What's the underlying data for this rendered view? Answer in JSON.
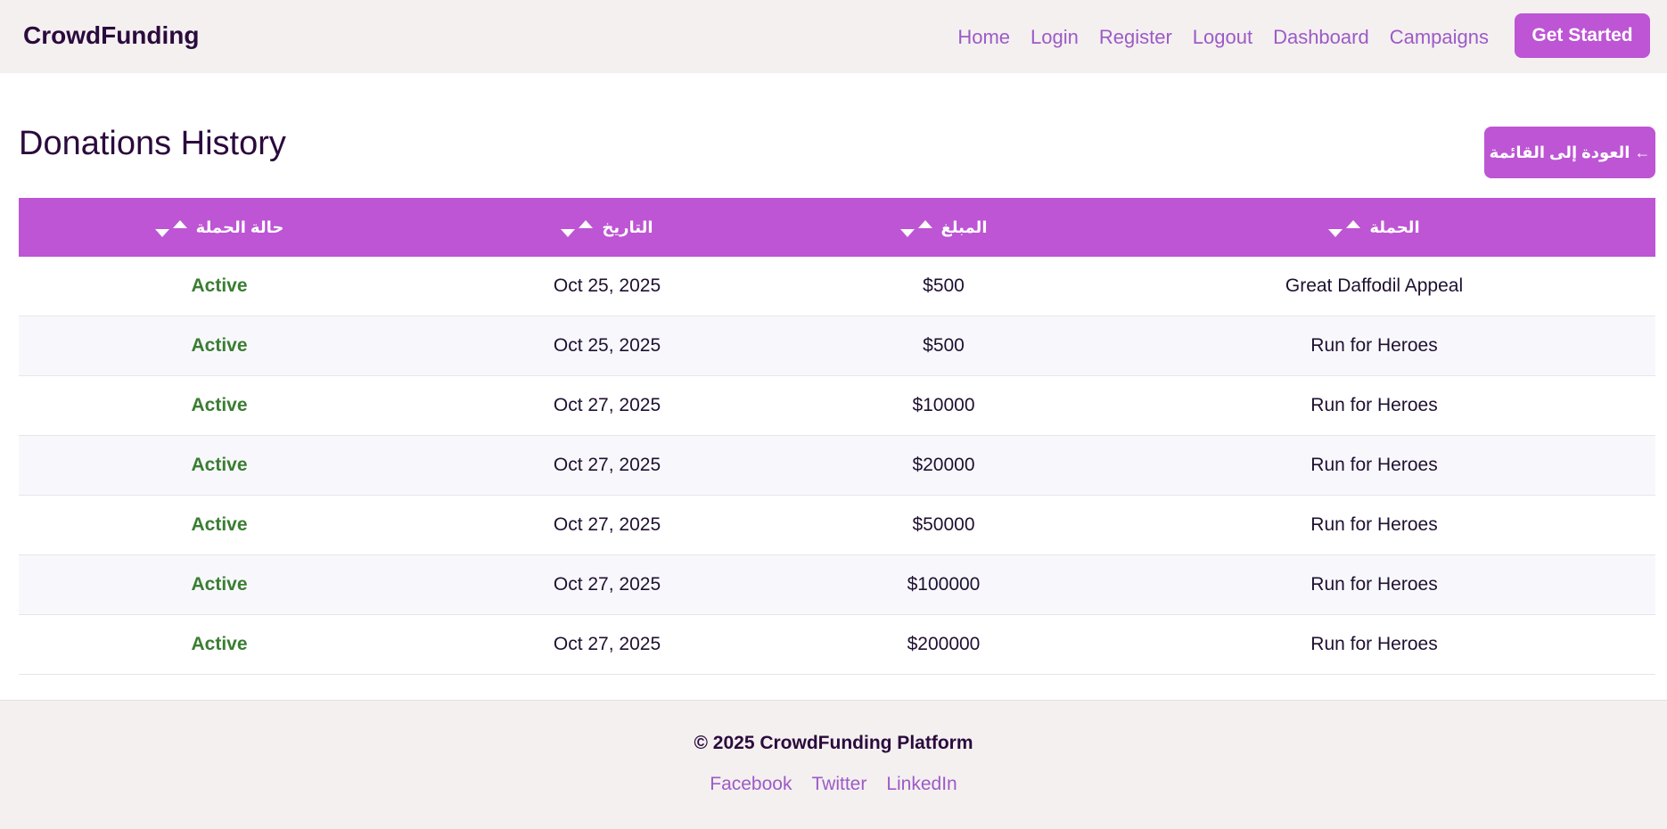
{
  "header": {
    "brand": "CrowdFunding",
    "nav": [
      "Home",
      "Login",
      "Register",
      "Logout",
      "Dashboard",
      "Campaigns"
    ],
    "cta_label": "Get Started"
  },
  "page": {
    "title": "Donations History",
    "back_label": "← العودة إلى القائمة"
  },
  "table": {
    "columns": [
      "حالة الحملة",
      "التاريخ",
      "المبلغ",
      "الحملة"
    ],
    "rows": [
      {
        "status": "Active",
        "date": "Oct 25, 2025",
        "amount": "$500",
        "campaign": "Great Daffodil Appeal"
      },
      {
        "status": "Active",
        "date": "Oct 25, 2025",
        "amount": "$500",
        "campaign": "Run for Heroes"
      },
      {
        "status": "Active",
        "date": "Oct 27, 2025",
        "amount": "$10000",
        "campaign": "Run for Heroes"
      },
      {
        "status": "Active",
        "date": "Oct 27, 2025",
        "amount": "$20000",
        "campaign": "Run for Heroes"
      },
      {
        "status": "Active",
        "date": "Oct 27, 2025",
        "amount": "$50000",
        "campaign": "Run for Heroes"
      },
      {
        "status": "Active",
        "date": "Oct 27, 2025",
        "amount": "$100000",
        "campaign": "Run for Heroes"
      },
      {
        "status": "Active",
        "date": "Oct 27, 2025",
        "amount": "$200000",
        "campaign": "Run for Heroes"
      }
    ]
  },
  "footer": {
    "copyright": "© 2025 CrowdFunding Platform",
    "links": [
      "Facebook",
      "Twitter",
      "LinkedIn"
    ]
  },
  "colors": {
    "accent": "#bd55d4",
    "link": "#9c5bc6",
    "status_active": "#3a7d32",
    "text_dark": "#2b0a3d"
  },
  "icons": [
    "sort-up-icon",
    "sort-down-icon",
    "arrow-left-icon"
  ]
}
